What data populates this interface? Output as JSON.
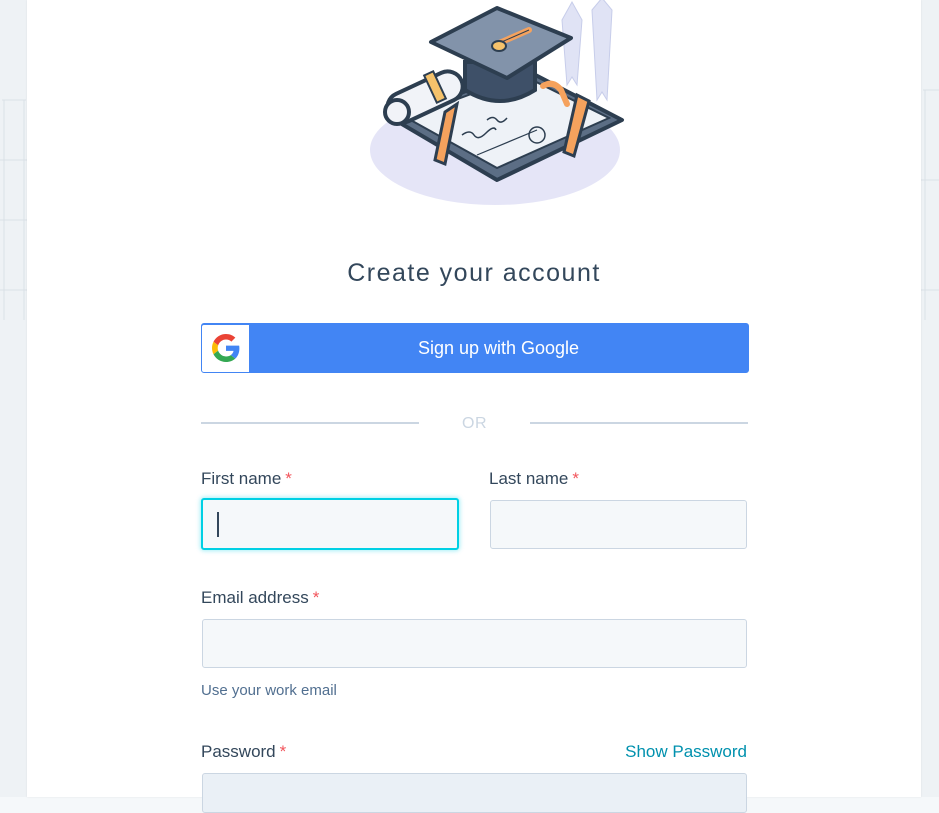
{
  "page": {
    "heading": "Create your account"
  },
  "google": {
    "label": "Sign up with Google",
    "icon": "google-g-logo-icon"
  },
  "divider": {
    "text": "OR"
  },
  "form": {
    "first_name": {
      "label": "First name",
      "required_mark": "*",
      "value": ""
    },
    "last_name": {
      "label": "Last name",
      "required_mark": "*",
      "value": ""
    },
    "email": {
      "label": "Email address",
      "required_mark": "*",
      "value": "",
      "hint": "Use your work email"
    },
    "password": {
      "label": "Password",
      "required_mark": "*",
      "value": "",
      "toggle": "Show Password"
    }
  },
  "colors": {
    "google_blue": "#4285f4",
    "focus_ring": "#00d0e4",
    "link": "#0091ae",
    "required": "#f2545b"
  }
}
